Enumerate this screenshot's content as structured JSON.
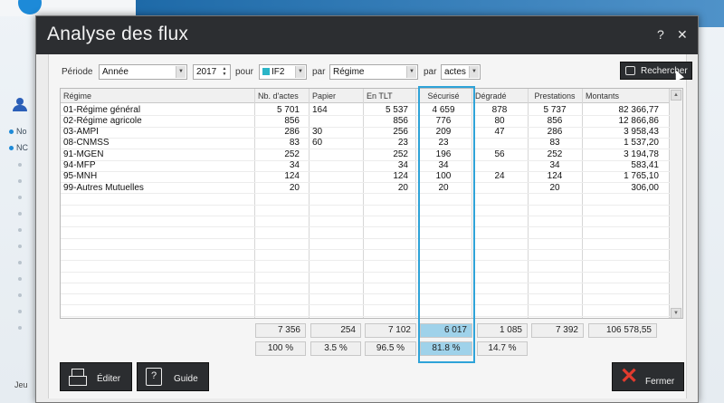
{
  "background": {
    "sidebar_items": [
      "No",
      "NC"
    ],
    "footer_text": "Jeu"
  },
  "dialog": {
    "title": "Analyse des flux",
    "help_label": "?",
    "close_label": "✕"
  },
  "filters": {
    "periode_label": "Période",
    "periode_value": "Année",
    "year_value": "2017",
    "pour_label": "pour",
    "pour_value": "IF2",
    "par_label": "par",
    "par_value": "Régime",
    "par2_label": "par",
    "par2_value": "actes"
  },
  "search_button": "Rechercher",
  "table": {
    "columns": [
      "Régime",
      "Nb. d'actes",
      "Papier",
      "En TLT",
      "Sécurisé",
      "Dégradé",
      "Prestations",
      "Montants"
    ],
    "rows": [
      [
        "01-Régime général",
        "5 701",
        "164",
        "5 537",
        "4 659",
        "878",
        "5 737",
        "82 366,77"
      ],
      [
        "02-Régime agricole",
        "856",
        "",
        "856",
        "776",
        "80",
        "856",
        "12 866,86"
      ],
      [
        "03-AMPI",
        "286",
        "30",
        "256",
        "209",
        "47",
        "286",
        "3 958,43"
      ],
      [
        "08-CNMSS",
        "83",
        "60",
        "23",
        "23",
        "",
        "83",
        "1 537,20"
      ],
      [
        "91-MGEN",
        "252",
        "",
        "252",
        "196",
        "56",
        "252",
        "3 194,78"
      ],
      [
        "94-MFP",
        "34",
        "",
        "34",
        "34",
        "",
        "34",
        "583,41"
      ],
      [
        "95-MNH",
        "124",
        "",
        "124",
        "100",
        "24",
        "124",
        "1 765,10"
      ],
      [
        "99-Autres Mutuelles",
        "20",
        "",
        "20",
        "20",
        "",
        "20",
        "306,00"
      ]
    ],
    "totals": [
      "7 356",
      "254",
      "7 102",
      "6 017",
      "1 085",
      "7 392",
      "106 578,55"
    ],
    "percents": [
      "100 %",
      "3.5 %",
      "96.5 %",
      "81.8 %",
      "14.7 %"
    ]
  },
  "buttons": {
    "edit": "Éditer",
    "guide": "Guide",
    "close": "Fermer"
  },
  "colors": {
    "titlebar": "#2c2e31",
    "highlight": "#2fa3d8",
    "close_icon": "#e23b2e"
  }
}
